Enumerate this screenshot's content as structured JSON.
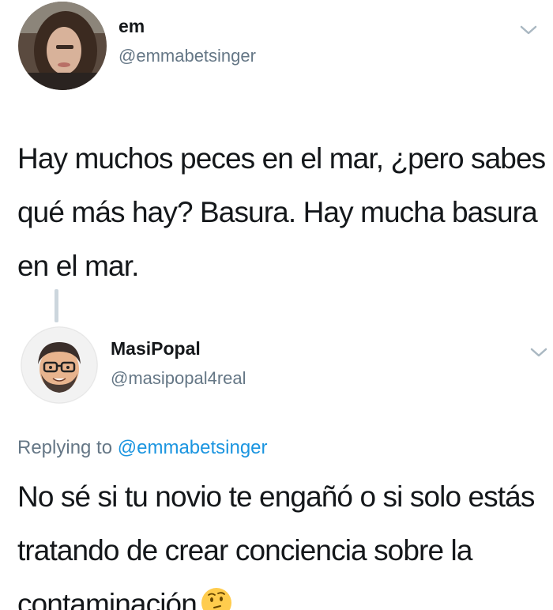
{
  "original_tweet": {
    "display_name": "em",
    "handle": "@emmabetsinger",
    "text": "Hay muchos peces en el mar, ¿pero sabes qué más hay? Basura. Hay mucha basura en el mar."
  },
  "reply_tweet": {
    "display_name": "MasiPopal",
    "handle": "@masipopal4real",
    "replying_prefix": "Replying to",
    "replying_to": "@emmabetsinger",
    "text": "No sé si tu novio te engañó o si solo estás tratando de crear conciencia sobre la contaminación",
    "emoji": "thinking-face"
  },
  "colors": {
    "text_primary": "#14171a",
    "text_secondary": "#657786",
    "link": "#1b95e0",
    "thread_line": "#ccd6dd"
  }
}
